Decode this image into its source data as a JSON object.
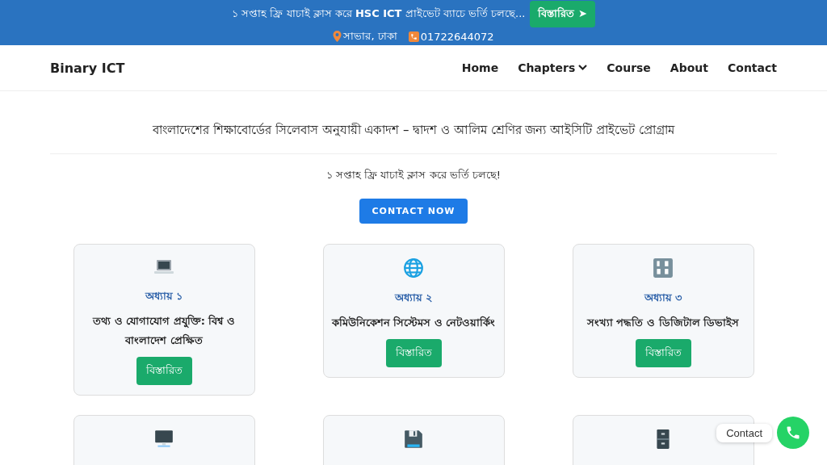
{
  "announcement": {
    "text": "১ সপ্তাহ ফ্রি যাচাই ক্লাস করে **HSC ICT** প্রাইভেট ব্যাচে ভর্তি চলছে...",
    "button": "বিস্তারিত ➤",
    "location": "সাভার, ঢাকা",
    "phone": "01722644072"
  },
  "nav": {
    "brand": "Binary ICT",
    "items": [
      {
        "label": "Home",
        "dropdown": false
      },
      {
        "label": "Chapters",
        "dropdown": true
      },
      {
        "label": "Course",
        "dropdown": false
      },
      {
        "label": "About",
        "dropdown": false
      },
      {
        "label": "Contact",
        "dropdown": false
      }
    ]
  },
  "hero": {
    "heading": "বাংলাদেশের শিক্ষাবোর্ডের সিলেবাস অনুযায়ী একাদশ – দ্বাদশ ও আলিম শ্রেণির জন্য আইসিটি প্রাইভেট প্রোগ্রাম",
    "subtext": "১ সপ্তাহ ফ্রি যাচাই ক্লাস করে ভর্তি চলছে!",
    "button": "CONTACT NOW"
  },
  "chapters": [
    {
      "kind": "chapter",
      "chapter": "অধ্যায় ১",
      "title": "তথ্য ও যোগাযোগ প্রযুক্তি: বিশ্ব ও বাংলাদেশ প্রেক্ষিত",
      "button": "বিস্তারিত"
    },
    {
      "kind": "chapter",
      "chapter": "অধ্যায় ২",
      "title": "কমিউনিকেশন সিস্টেমস ও নেটওয়ার্কিং",
      "button": "বিস্তারিত"
    },
    {
      "kind": "chapter",
      "chapter": "অধ্যায় ৩",
      "title": "সংখ্যা পদ্ধতি ও ডিজিটাল ডিভাইস",
      "button": "বিস্তারিত"
    },
    {
      "kind": "cut_off"
    },
    {
      "kind": "cut_off"
    },
    {
      "kind": "cut_off"
    }
  ],
  "float_contact": {
    "label": "Contact"
  }
}
